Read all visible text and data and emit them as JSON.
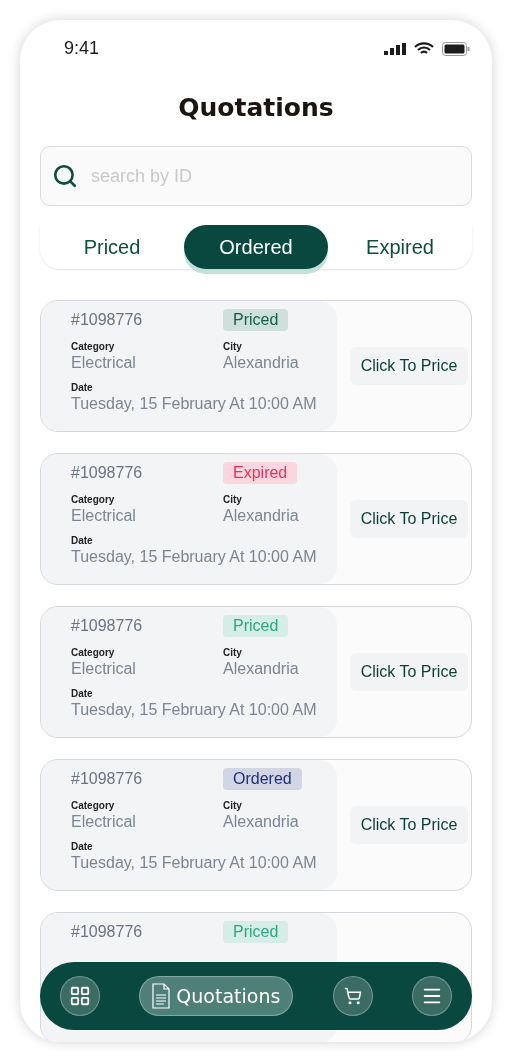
{
  "status_bar": {
    "time": "9:41"
  },
  "title": "Quotations",
  "search": {
    "placeholder": "search by ID"
  },
  "tabs": [
    {
      "label": "Priced",
      "selected": false
    },
    {
      "label": "Ordered",
      "selected": true
    },
    {
      "label": "Expired",
      "selected": false
    }
  ],
  "quotations": [
    {
      "id": "#1098776",
      "status": "Priced",
      "color": "#0f5f4a",
      "category_label": "Category",
      "category": "Electrical",
      "city_label": "City",
      "city": "Alexandria",
      "date_label": "Date",
      "date": "Tuesday, 15 February At 10:00 AM",
      "action": "Click To Price"
    },
    {
      "id": "#1098776",
      "status": "Expired",
      "color": "#e8325a",
      "category_label": "Category",
      "category": "Electrical",
      "city_label": "City",
      "city": "Alexandria",
      "date_label": "Date",
      "date": "Tuesday, 15 February At 10:00 AM",
      "action": "Click To Price"
    },
    {
      "id": "#1098776",
      "status": "Priced",
      "color": "#2fa683",
      "category_label": "Category",
      "category": "Electrical",
      "city_label": "City",
      "city": "Alexandria",
      "date_label": "Date",
      "date": "Tuesday, 15 February At 10:00 AM",
      "action": "Click To Price"
    },
    {
      "id": "#1098776",
      "status": "Ordered",
      "color": "#1f2f7a",
      "category_label": "Category",
      "category": "Electrical",
      "city_label": "City",
      "city": "Alexandria",
      "date_label": "Date",
      "date": "Tuesday, 15 February At 10:00 AM",
      "action": "Click To Price"
    },
    {
      "id": "#1098776",
      "status": "Priced",
      "color": "#2fa683"
    }
  ],
  "bottom_nav": [
    {
      "kind": "grid",
      "selected": false
    },
    {
      "kind": "quotations",
      "label": "Quotations",
      "selected": true
    },
    {
      "kind": "cart",
      "selected": false
    },
    {
      "kind": "menu",
      "selected": false
    }
  ]
}
